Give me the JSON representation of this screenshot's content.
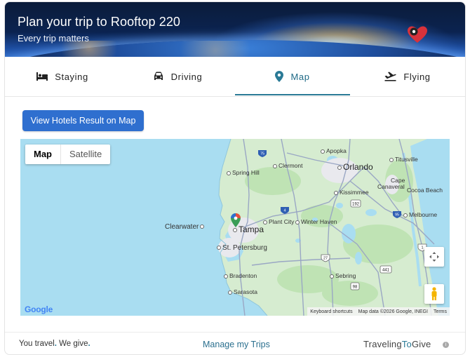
{
  "header": {
    "title": "Plan your trip to Rooftop 220",
    "subtitle": "Every trip matters"
  },
  "tabs": [
    {
      "label": "Staying",
      "icon": "bed-icon"
    },
    {
      "label": "Driving",
      "icon": "car-icon"
    },
    {
      "label": "Map",
      "icon": "map-pin-icon",
      "active": true
    },
    {
      "label": "Flying",
      "icon": "plane-icon"
    }
  ],
  "actions": {
    "view_hotels_label": "View Hotels Result on Map"
  },
  "map": {
    "type_options": [
      "Map",
      "Satellite"
    ],
    "selected_type": "Map",
    "cities": {
      "apopka": "Apopka",
      "orlando": "Orlando",
      "clermont": "Clermont",
      "spring_hill": "Spring Hill",
      "titusville": "Titusville",
      "kissimmee": "Kissimmee",
      "cape_canaveral_1": "Cape",
      "cape_canaveral_2": "Canaveral",
      "cocoa_beach": "Cocoa Beach",
      "clearwater": "Clearwater",
      "tampa": "Tampa",
      "plant_city": "Plant City",
      "winter_haven": "Winter Haven",
      "melbourne": "Melbourne",
      "st_petersburg": "St. Petersburg",
      "bradenton": "Bradenton",
      "sebring": "Sebring",
      "sarasota": "Sarasota"
    },
    "highway_shields": [
      "75",
      "192",
      "4",
      "95",
      "27",
      "441",
      "98",
      "1"
    ],
    "attribution": {
      "shortcuts": "Keyboard shortcuts",
      "data": "Map data ©2026 Google, INEGI",
      "terms": "Terms"
    },
    "google_logo": "Google"
  },
  "footer": {
    "tagline_1": "You travel",
    "tagline_2": "We give",
    "manage_trips": "Manage my Trips",
    "brand_1": "Traveling",
    "brand_2": "To",
    "brand_3": "Give",
    "info_glyph": "i"
  },
  "colors": {
    "accent": "#2a7a96",
    "button": "#2f6fcf",
    "map_water": "#a9ddf1",
    "map_land": "#d6ecd0"
  }
}
